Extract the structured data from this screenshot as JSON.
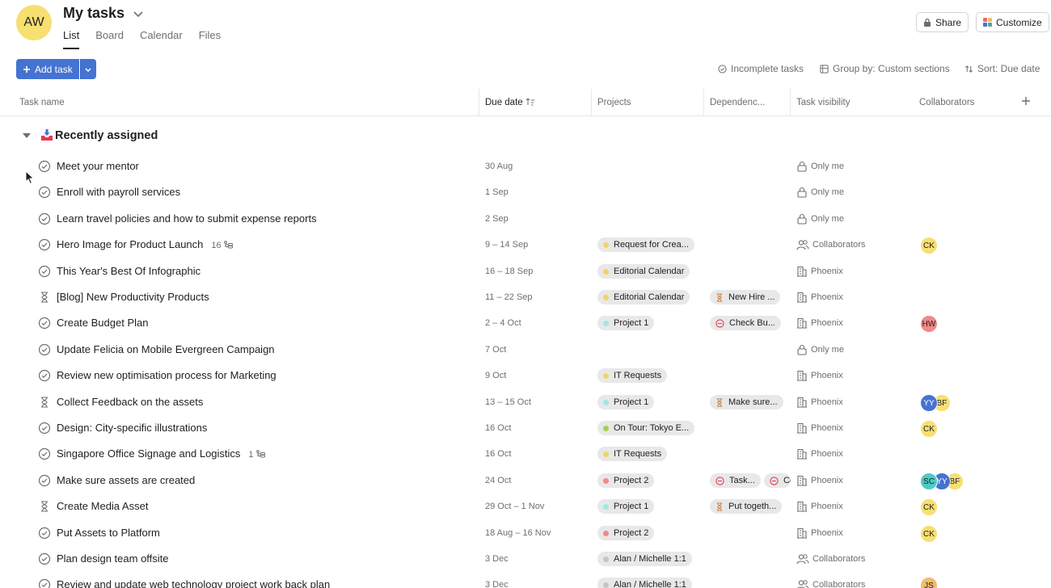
{
  "user_initials": "AW",
  "page_title": "My tasks",
  "tabs": [
    "List",
    "Board",
    "Calendar",
    "Files"
  ],
  "header_buttons": {
    "share": "Share",
    "customize": "Customize"
  },
  "toolbar": {
    "add_task": "Add task",
    "incomplete": "Incomplete tasks",
    "group_by": "Group by: Custom sections",
    "sort": "Sort: Due date"
  },
  "columns": {
    "task_name": "Task name",
    "due_date": "Due date",
    "projects": "Projects",
    "dependencies": "Dependenc...",
    "visibility": "Task visibility",
    "collaborators": "Collaborators"
  },
  "section_title": "Recently assigned",
  "colors": {
    "Request for Crea...": "#f5d365",
    "Editorial Calendar": "#f5d365",
    "Project 1": "#9ee7e3",
    "IT Requests": "#f5d365",
    "On Tour: Tokyo E...": "#a7cf4e",
    "Project 2": "#f08a8a",
    "Alan / Michelle 1:1": "#c7c4c4"
  },
  "avatar_colors": {
    "CK": "#f8df72",
    "HW": "#f08a8a",
    "YY": "#4573d2",
    "BF": "#f8df72",
    "SC": "#4ecbc4",
    "JS": "#f1bd6c"
  },
  "rows": [
    {
      "name": "Meet your mentor",
      "status": "check",
      "due": "30 Aug",
      "vis": "Only me",
      "vis_icon": "lock"
    },
    {
      "name": "Enroll with payroll services",
      "status": "check",
      "due": "1 Sep",
      "vis": "Only me",
      "vis_icon": "lock"
    },
    {
      "name": "Learn travel policies and how to submit expense reports",
      "status": "check",
      "due": "2 Sep",
      "vis": "Only me",
      "vis_icon": "lock"
    },
    {
      "name": "Hero Image for Product Launch",
      "status": "check",
      "sub": "16",
      "due": "9 – 14 Sep",
      "project": "Request for Crea...",
      "vis": "Collaborators",
      "vis_icon": "people",
      "collabs": [
        "CK"
      ]
    },
    {
      "name": "This Year's Best Of Infographic",
      "status": "check",
      "due": "16 – 18 Sep",
      "project": "Editorial Calendar",
      "vis": "Phoenix",
      "vis_icon": "building"
    },
    {
      "name": "[Blog] New Productivity Products",
      "status": "hourglass",
      "due": "11 – 22 Sep",
      "project": "Editorial Calendar",
      "dep": "New Hire ...",
      "dep_icon": "hourglass",
      "vis": "Phoenix",
      "vis_icon": "building"
    },
    {
      "name": "Create Budget Plan",
      "status": "check",
      "due": "2 – 4 Oct",
      "project": "Project 1",
      "dep": "Check Bu...",
      "dep_icon": "block",
      "vis": "Phoenix",
      "vis_icon": "building",
      "collabs": [
        "HW"
      ]
    },
    {
      "name": "Update Felicia on Mobile Evergreen Campaign",
      "status": "check",
      "due": "7 Oct",
      "vis": "Only me",
      "vis_icon": "lock"
    },
    {
      "name": "Review new optimisation process for Marketing",
      "status": "check",
      "due": "9 Oct",
      "project": "IT Requests",
      "vis": "Phoenix",
      "vis_icon": "building"
    },
    {
      "name": "Collect Feedback on the assets",
      "status": "hourglass",
      "due": "13 – 15 Oct",
      "project": "Project 1",
      "dep": "Make sure...",
      "dep_icon": "hourglass",
      "vis": "Phoenix",
      "vis_icon": "building",
      "collabs": [
        "YY",
        "BF"
      ]
    },
    {
      "name": "Design: City-specific illustrations",
      "status": "check",
      "due": "16 Oct",
      "project": "On Tour: Tokyo E...",
      "vis": "Phoenix",
      "vis_icon": "building",
      "collabs": [
        "CK"
      ]
    },
    {
      "name": "Singapore Office Signage and Logistics",
      "status": "check",
      "sub": "1",
      "due": "16 Oct",
      "project": "IT Requests",
      "vis": "Phoenix",
      "vis_icon": "building"
    },
    {
      "name": "Make sure assets are created",
      "status": "check",
      "due": "24 Oct",
      "project": "Project 2",
      "dep": "Task...",
      "dep_icon": "block",
      "dep2": "Co",
      "vis": "Phoenix",
      "vis_icon": "building",
      "collabs": [
        "SC",
        "YY",
        "BF"
      ]
    },
    {
      "name": "Create Media Asset",
      "status": "hourglass",
      "due": "29 Oct – 1 Nov",
      "project": "Project 1",
      "dep": "Put togeth...",
      "dep_icon": "hourglass",
      "vis": "Phoenix",
      "vis_icon": "building",
      "collabs": [
        "CK"
      ]
    },
    {
      "name": "Put Assets to Platform",
      "status": "check",
      "due": "18 Aug – 16 Nov",
      "project": "Project 2",
      "vis": "Phoenix",
      "vis_icon": "building",
      "collabs": [
        "CK"
      ]
    },
    {
      "name": "Plan design team offsite",
      "status": "check",
      "due": "3 Dec",
      "project": "Alan / Michelle 1:1",
      "vis": "Collaborators",
      "vis_icon": "people"
    },
    {
      "name": "Review and update web technology project work back plan",
      "status": "check",
      "due": "3 Dec",
      "project": "Alan / Michelle 1:1",
      "vis": "Collaborators",
      "vis_icon": "people",
      "collabs": [
        "JS"
      ]
    }
  ]
}
